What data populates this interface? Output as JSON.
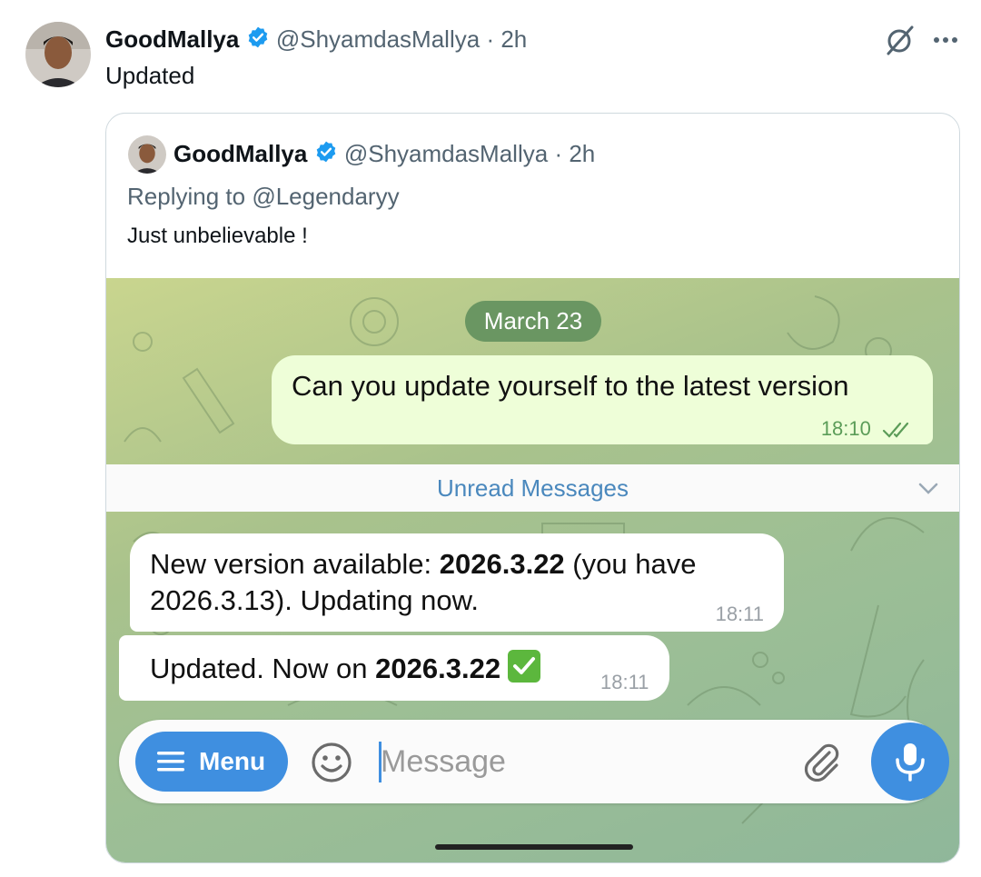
{
  "tweet": {
    "author_name": "GoodMallya",
    "handle": "@ShyamdasMallya",
    "separator": "·",
    "time": "2h",
    "text": "Updated"
  },
  "quoted": {
    "author_name": "GoodMallya",
    "handle": "@ShyamdasMallya",
    "separator": "·",
    "time": "2h",
    "replying_prefix": "Replying to",
    "replying_to": "@Legendaryy",
    "text": "Just unbelievable !"
  },
  "chat": {
    "date": "March 23",
    "outgoing": {
      "text": "Can you update yourself to the latest version",
      "time": "18:10"
    },
    "unread_label": "Unread Messages",
    "incoming": [
      {
        "pre": "New version available: ",
        "bold": "2026.3.22",
        "post": " (you have 2026.3.13). Updating now.",
        "time": "18:11"
      },
      {
        "pre": "Updated. Now on ",
        "bold": "2026.3.22",
        "time": "18:11"
      }
    ],
    "menu_label": "Menu",
    "input_placeholder": "Message"
  },
  "colors": {
    "verified": "#1d9bf0",
    "telegram_blue": "#3f8fe0",
    "outgoing_bubble": "#eefed8",
    "date_pill": "#6a9662"
  },
  "icons": [
    "verified-badge-icon",
    "grok-icon",
    "more-icon",
    "double-check-icon",
    "chevron-down-icon",
    "menu-lines-icon",
    "emoji-icon",
    "paperclip-icon",
    "microphone-icon",
    "check-mark-emoji"
  ]
}
